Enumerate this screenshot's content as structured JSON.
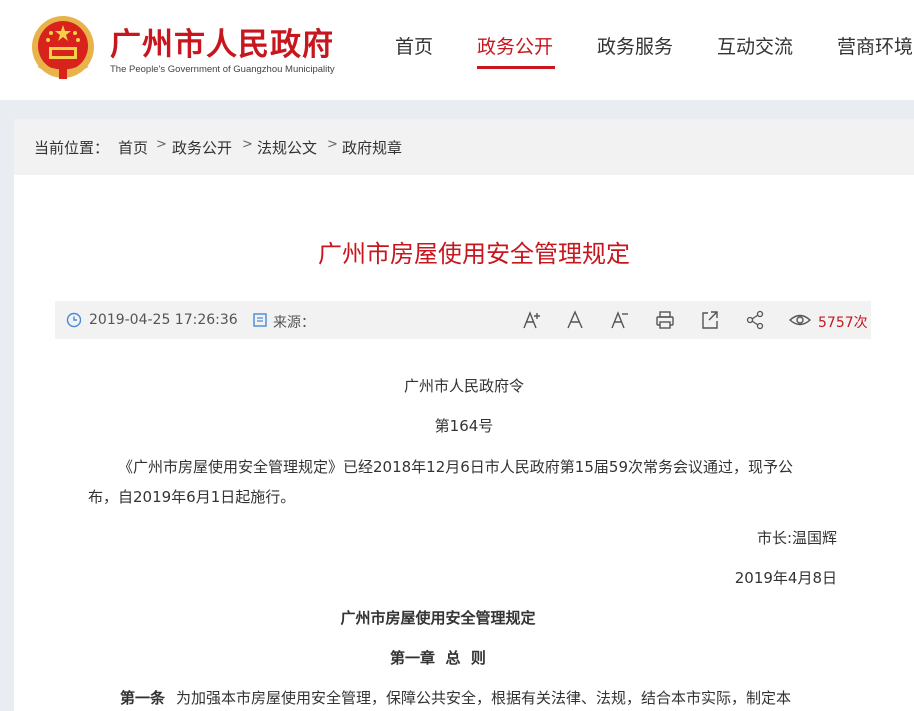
{
  "header": {
    "site_title": "广州市人民政府",
    "site_subtitle": "The People's Government of Guangzhou Municipality",
    "nav": [
      "首页",
      "政务公开",
      "政务服务",
      "互动交流",
      "营商环境"
    ]
  },
  "breadcrumb": {
    "prefix": "当前位置：",
    "items": [
      "首页",
      "政务公开",
      "法规公文",
      "政府规章"
    ]
  },
  "article": {
    "title": "广州市房屋使用安全管理规定",
    "date": "2019-04-25 17:26:36",
    "source_label": "来源：",
    "views": "5757次",
    "p1": "广州市人民政府令",
    "p2": "第164号",
    "p3a": "《广州市房屋使用安全管理规定》已经2018年12月6日市人民政府第15届59次常务会议通过，现予公",
    "p3b": "布，自2019年6月1日起施行。",
    "signer": "市长:温国辉",
    "sign_date": "2019年4月8日",
    "sub_title": "广州市房屋使用安全管理规定",
    "chapter": "第一章  总  则",
    "article1_label": "第一条",
    "article1_text": "为加强本市房屋使用安全管理，保障公共安全，根据有关法律、法规，结合本市实际，制定本"
  },
  "colors": {
    "brand_red": "#c7161e",
    "page_bg": "#e9edf2",
    "bar_bg": "#f2f2f2"
  },
  "icons": [
    "national-emblem-icon",
    "clock-icon",
    "source-icon",
    "font-increase-icon",
    "font-normal-icon",
    "font-decrease-icon",
    "print-icon",
    "share-out-icon",
    "share-icon",
    "eye-icon"
  ]
}
